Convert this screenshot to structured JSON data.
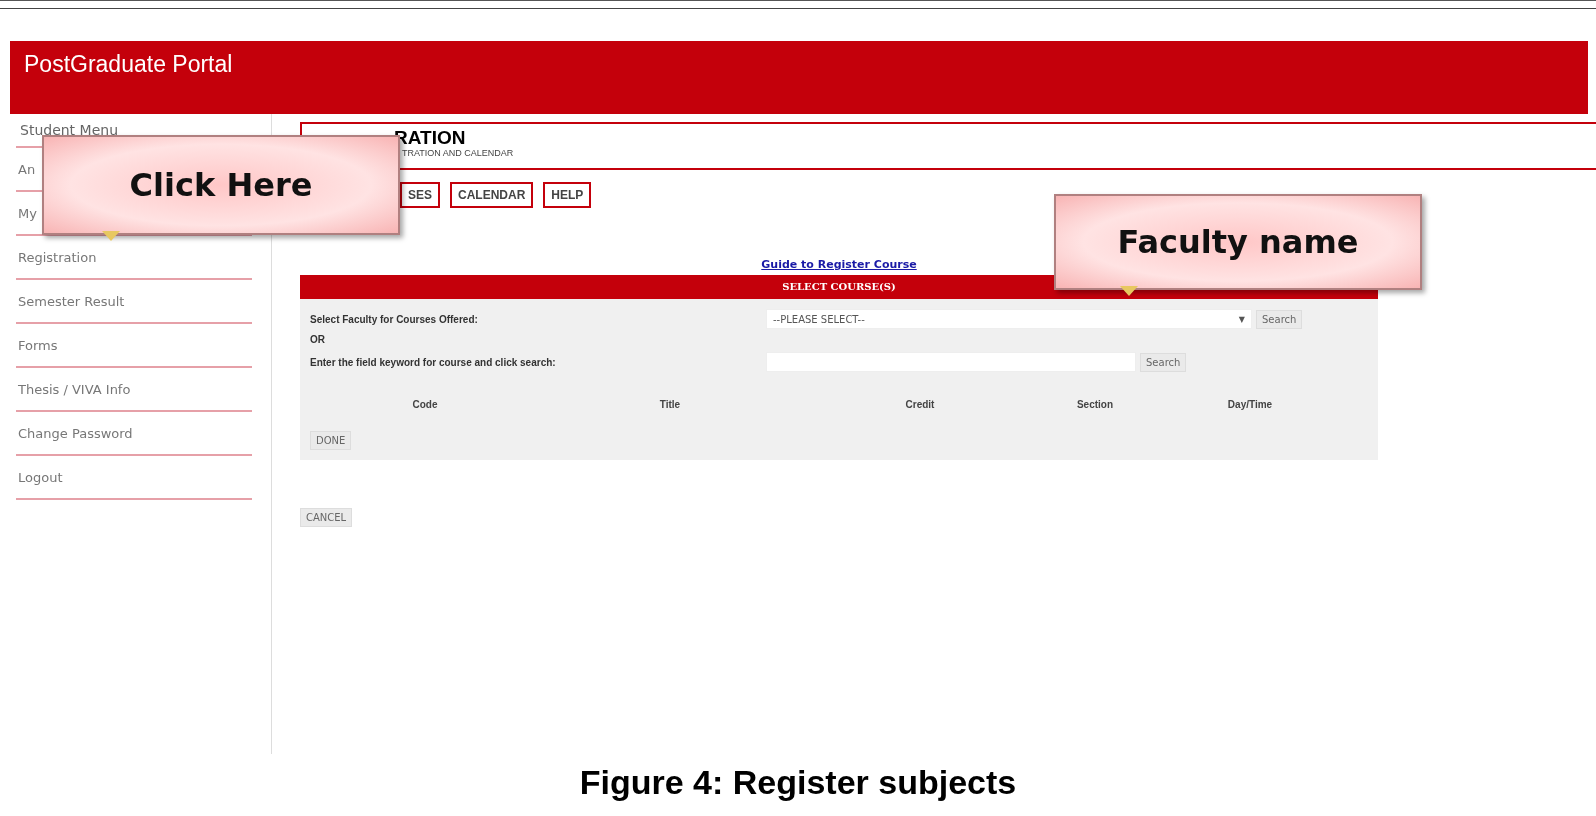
{
  "header": {
    "title": "PostGraduate Portal"
  },
  "sidebar": {
    "heading": "Student Menu",
    "items": [
      {
        "label": "An",
        "selected": false
      },
      {
        "label": "My",
        "selected": false
      },
      {
        "label": "Registration",
        "selected": false
      },
      {
        "label": "Semester Result",
        "selected": false
      },
      {
        "label": "Forms",
        "selected": false
      },
      {
        "label": "Thesis / VIVA Info",
        "selected": false
      },
      {
        "label": "Change Password",
        "selected": false
      },
      {
        "label": "Logout",
        "selected": false
      }
    ]
  },
  "page_title": {
    "title": "RATION",
    "subtitle": "TRATION AND CALENDAR"
  },
  "tabs": [
    {
      "label": "SES"
    },
    {
      "label": "CALENDAR"
    },
    {
      "label": "HELP"
    }
  ],
  "guide_link": "Guide to Register Course",
  "panel": {
    "title": "SELECT COURSE(S)",
    "faculty_label": "Select Faculty for Courses Offered:",
    "faculty_select": "--PLEASE SELECT--",
    "faculty_select_arrow": "▼",
    "faculty_search": "Search",
    "or": "OR",
    "keyword_label": "Enter the field keyword for course and click search:",
    "keyword_search": "Search",
    "columns": [
      "Code",
      "Title",
      "Credit",
      "Section",
      "Day/Time"
    ],
    "done": "DONE"
  },
  "cancel": "CANCEL",
  "callouts": [
    {
      "text": "Click Here"
    },
    {
      "text": "Faculty name"
    }
  ],
  "caption": "Figure 4: Register subjects"
}
